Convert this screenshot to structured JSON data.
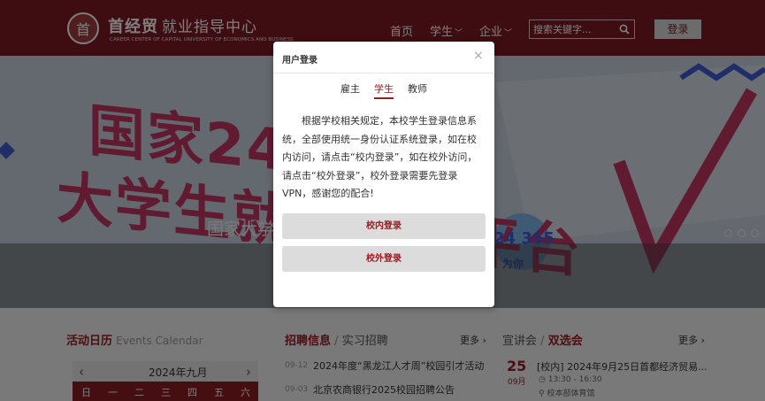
{
  "header": {
    "logo_text": "首",
    "brand_cn_part1": "首经贸",
    "brand_cn_part2": "就业指导中心",
    "brand_en": "CAREER CENTER OF CAPITAL UNIVERSITY OF ECONOMICS AND BUSINESS",
    "nav": [
      {
        "label": "首页",
        "has_menu": false
      },
      {
        "label": "学生",
        "has_menu": true
      },
      {
        "label": "企业",
        "has_menu": true
      }
    ],
    "search_placeholder": "搜索关键字...",
    "login_label": "登录"
  },
  "banner": {
    "title_line1": "国家24365",
    "title_line2": "大学生就业服务平台",
    "caption": "国家大学生就业服务平台 · 招聘服务",
    "badge_number": "24 365",
    "badge_sub": "为你"
  },
  "lower": {
    "calendar": {
      "heading": "活动日历",
      "heading_en": "Events Calendar",
      "month_label": "2024年九月",
      "weekdays": [
        "日",
        "一",
        "二",
        "三",
        "四",
        "五",
        "六"
      ]
    },
    "jobs": {
      "heading": "招聘信息",
      "separator": "/",
      "subheading": "实习招聘",
      "more": "更多",
      "items": [
        {
          "date": "09-12",
          "title": "2024年度“黑龙江人才周”校园引才活动"
        },
        {
          "date": "09-03",
          "title": "北京农商银行2025校园招聘公告"
        }
      ]
    },
    "talks": {
      "heading_left": "宣讲会",
      "separator": "/",
      "heading_right": "双选会",
      "more": "更多",
      "item": {
        "day": "25",
        "month": "09月",
        "title": "[校内] 2024年9月25日首都经济贸易...",
        "time": "13:30 - 16:30",
        "place": "校本部体育馆"
      }
    }
  },
  "modal": {
    "title": "用户登录",
    "close": "×",
    "tabs": [
      "雇主",
      "学生",
      "教师"
    ],
    "active_tab": "学生",
    "body": "根据学校相关规定，本校学生登录信息系统，全部使用统一身份认证系统登录，如在校内访问，请点击“校内登录”，如在校外访问，请点击“校外登录”，校外登录需要先登录VPN，感谢您的配合!",
    "buttons": {
      "inside": "校内登录",
      "outside": "校外登录"
    }
  },
  "colors": {
    "brand": "#7d1a22",
    "accent": "#9c1a22",
    "banner_pink": "#c13663"
  }
}
